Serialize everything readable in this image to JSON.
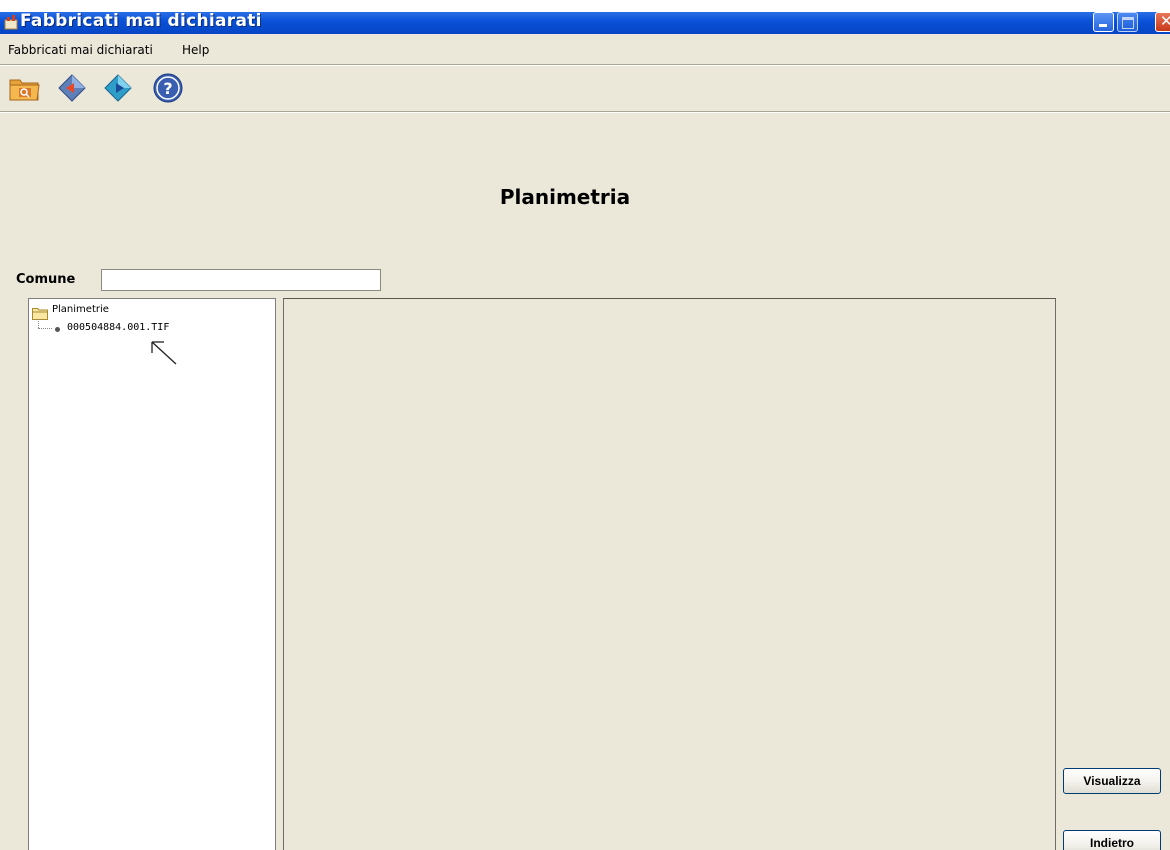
{
  "window": {
    "title": "Fabbricati mai dichiarati"
  },
  "menubar": {
    "items": [
      {
        "label": "Fabbricati mai dichiarati"
      },
      {
        "label": "Help"
      }
    ]
  },
  "toolbar": {
    "buttons": [
      {
        "icon": "folder-search-icon"
      },
      {
        "icon": "back-diamond-icon"
      },
      {
        "icon": "forward-diamond-icon"
      },
      {
        "icon": "help-icon"
      }
    ]
  },
  "page": {
    "title": "Planimetria"
  },
  "comune": {
    "label": "Comune",
    "value": ""
  },
  "tree": {
    "root_label": "Planimetrie",
    "items": [
      {
        "label": "000504884.001.TIF"
      }
    ]
  },
  "actions": {
    "visualizza": "Visualizza",
    "indietro": "Indietro"
  },
  "colors": {
    "titlebar": "#0a52d8",
    "window_bg": "#ebe8d9",
    "button_border": "#003c74"
  }
}
